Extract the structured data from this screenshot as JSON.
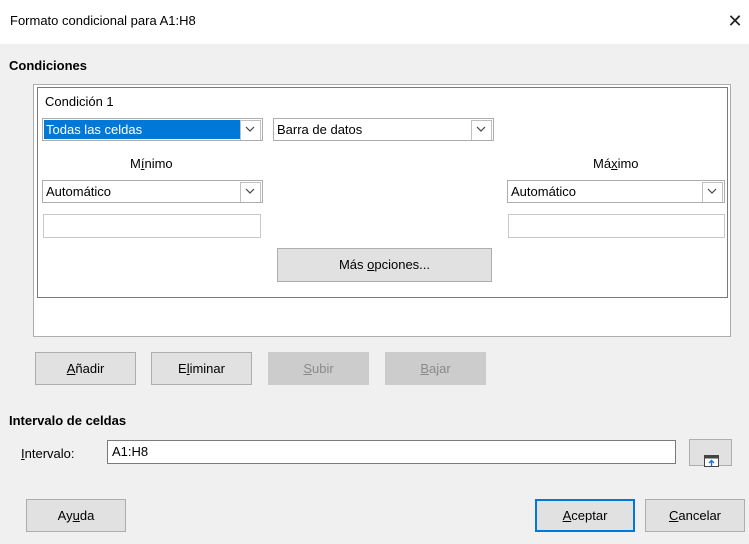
{
  "window": {
    "title": "Formato condicional para A1:H8",
    "close_glyph": "✕"
  },
  "conditions": {
    "section_label": "Condiciones",
    "condition_title": "Condición 1",
    "apply_to": "Todas las celdas",
    "format_type": "Barra de datos",
    "min": {
      "label_pre": "M",
      "label_u": "í",
      "label_post": "nimo",
      "type": "Automático",
      "value": ""
    },
    "max": {
      "label_pre": "Má",
      "label_u": "x",
      "label_post": "imo",
      "type": "Automático",
      "value": ""
    },
    "more_options": {
      "pre": "Más ",
      "u": "o",
      "post": "pciones..."
    }
  },
  "buttons": {
    "add": {
      "pre": "",
      "u": "A",
      "post": "ñadir"
    },
    "remove": {
      "pre": "E",
      "u": "l",
      "post": "iminar"
    },
    "up": {
      "pre": "",
      "u": "S",
      "post": "ubir"
    },
    "down": {
      "pre": "",
      "u": "B",
      "post": "ajar"
    },
    "help": {
      "pre": "Ay",
      "u": "u",
      "post": "da"
    },
    "ok": {
      "pre": "",
      "u": "A",
      "post": "ceptar"
    },
    "cancel": {
      "pre": "",
      "u": "C",
      "post": "ancelar"
    }
  },
  "range": {
    "section_label": "Intervalo de celdas",
    "label_u": "I",
    "label_post": "ntervalo:",
    "value": "A1:H8"
  },
  "colors": {
    "selection": "#0078d7",
    "disabled": "#cccccc"
  }
}
